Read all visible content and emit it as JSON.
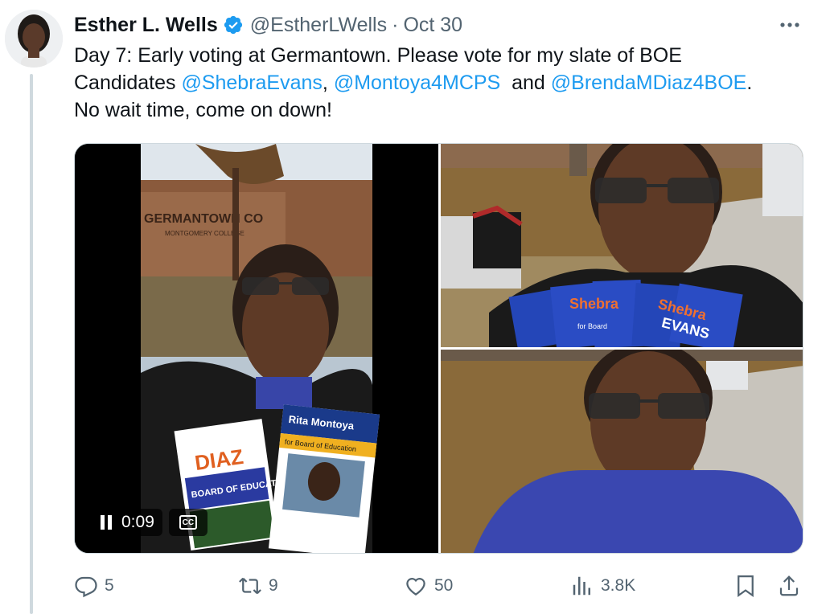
{
  "author": {
    "name": "Esther L. Wells",
    "handle": "@EstherLWells",
    "separator": "·",
    "date": "Oct 30"
  },
  "tweet": {
    "line1": "Day 7: Early voting at Germantown. Please vote for my slate of BOE",
    "line2_prefix": "Candidates ",
    "mention1": "@ShebraEvans",
    "comma": ",",
    "mention2": "@Montoya4MCPS",
    "and": "  and ",
    "mention3": "@BrendaMDiaz4BOE",
    "period": ".",
    "line3": "No wait time, come on down!"
  },
  "media": {
    "video_time": "0:09",
    "cc_label": "CC",
    "sign_text": "GERMANTOWN CO",
    "sign_subtext": "MONTGOMERY COLLEGE",
    "flyer_rita_name": "Rita Montoya",
    "flyer_rita_sub": "for Board of Education",
    "flyer_diaz_name": "DIAZ",
    "flyer_diaz_sub": "BOARD OF EDUCATION",
    "flyer_shebra": "Shebra",
    "flyer_evans": "EVANS",
    "flyer_for": "for Board"
  },
  "actions": {
    "replies": "5",
    "reposts": "9",
    "likes": "50",
    "views": "3.8K"
  },
  "colors": {
    "accent": "#1d9bf0",
    "secondary_text": "#536471",
    "border": "#cfd9de"
  },
  "icons": [
    "verified-badge-icon",
    "more-icon",
    "pause-icon",
    "cc-icon",
    "reply-icon",
    "repost-icon",
    "like-icon",
    "views-icon",
    "bookmark-icon",
    "share-icon"
  ]
}
